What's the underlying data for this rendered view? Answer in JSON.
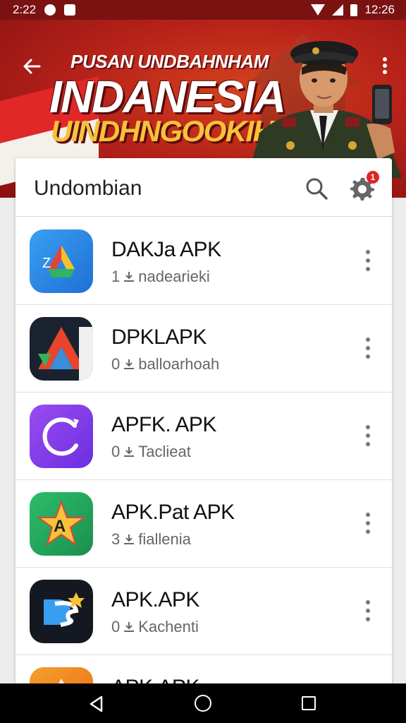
{
  "status_bar": {
    "time_left": "2:22",
    "time_right": "12:26"
  },
  "header": {
    "title_line1": "PUSAN UNDBAHNHAM",
    "title_line2": "INDANESIA",
    "title_line3": "UINDHNGOOKIH"
  },
  "card": {
    "title": "Undombian",
    "notification_count": "1"
  },
  "apps": [
    {
      "name": "DAKJa APK",
      "downloads": "1",
      "subtitle": "nadearieki",
      "icon": "drive-style-icon"
    },
    {
      "name": "DPKLAPK",
      "downloads": "0",
      "subtitle": "balloarhoah",
      "icon": "red-a-icon"
    },
    {
      "name": "APFK. APK",
      "downloads": "0",
      "subtitle": "Taclieat",
      "icon": "purple-c-icon"
    },
    {
      "name": "APK.Pat APK",
      "downloads": "3",
      "subtitle": "fiallenia",
      "icon": "star-a-icon"
    },
    {
      "name": "APK.APK",
      "downloads": "0",
      "subtitle": "Kachenti",
      "icon": "ds-logo-icon"
    },
    {
      "name": "APK.APK",
      "downloads": "",
      "subtitle": "",
      "icon": "orange-icon"
    }
  ],
  "colors": {
    "banner_red": "#b8231a",
    "status_bar": "#7a1212",
    "title_yellow": "#f6c23a",
    "badge_red": "#e02424"
  }
}
